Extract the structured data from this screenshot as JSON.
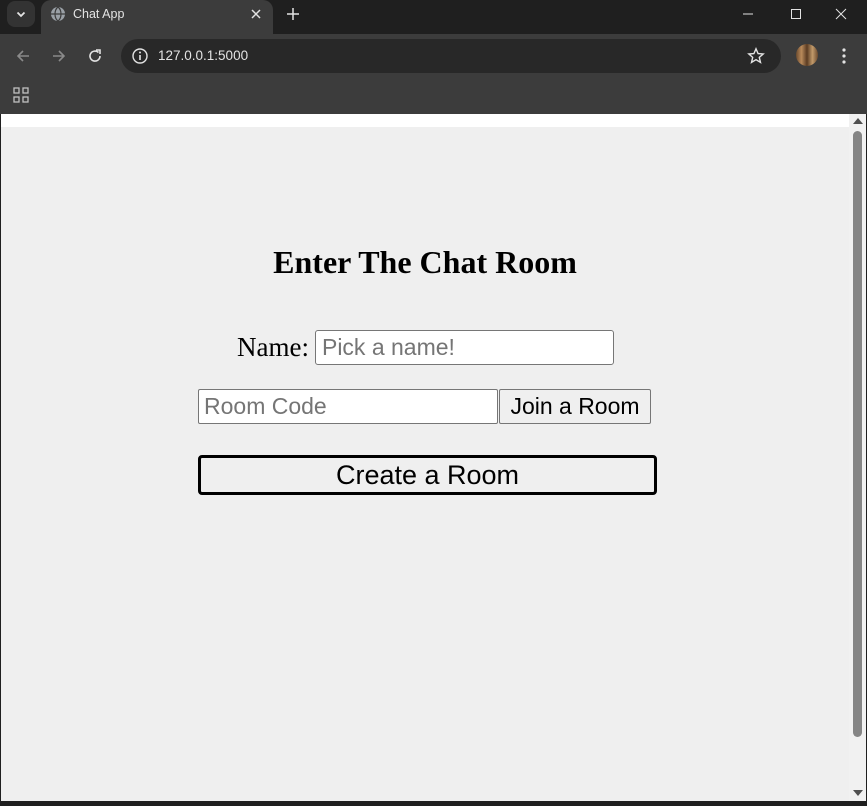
{
  "browser": {
    "tab_title": "Chat App",
    "url": "127.0.0.1:5000",
    "icons": [
      "tab-search-icon",
      "globe-icon",
      "close-icon",
      "plus-icon",
      "minimize-icon",
      "maximize-icon",
      "close-window-icon",
      "back-arrow-icon",
      "forward-arrow-icon",
      "reload-icon",
      "info-icon",
      "star-icon",
      "kebab-menu-icon",
      "apps-grid-icon"
    ]
  },
  "page": {
    "heading": "Enter The Chat Room",
    "name_label": "Name:",
    "name_input": {
      "value": "",
      "placeholder": "Pick a name!"
    },
    "room_input": {
      "value": "",
      "placeholder": "Room Code"
    },
    "join_button": "Join a Room",
    "create_button": "Create a Room"
  }
}
